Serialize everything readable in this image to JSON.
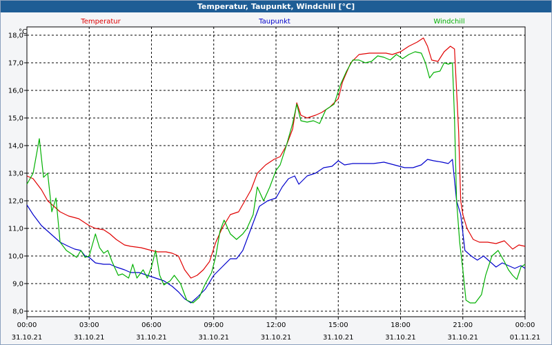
{
  "window": {
    "title": "Temperatur, Taupunkt, Windchill [°C]"
  },
  "chart_data": {
    "type": "line",
    "ylabel": "°C",
    "ylim": [
      7.8,
      18.3
    ],
    "yticks": [
      8.0,
      9.0,
      10.0,
      11.0,
      12.0,
      13.0,
      14.0,
      15.0,
      16.0,
      17.0,
      18.0
    ],
    "ytick_labels": [
      "8,0",
      "9,0",
      "10,0",
      "11,0",
      "12,0",
      "13,0",
      "14,0",
      "15,0",
      "16,0",
      "17,0",
      "18,0"
    ],
    "xlim": [
      0,
      24
    ],
    "xticks": [
      0,
      3,
      6,
      9,
      12,
      15,
      18,
      21,
      24
    ],
    "xtick_labels": [
      [
        "00:00",
        "31.10.21"
      ],
      [
        "03:00",
        "31.10.21"
      ],
      [
        "06:00",
        "31.10.21"
      ],
      [
        "09:00",
        "31.10.21"
      ],
      [
        "12:00",
        "31.10.21"
      ],
      [
        "15:00",
        "31.10.21"
      ],
      [
        "18:00",
        "31.10.21"
      ],
      [
        "21:00",
        "31.10.21"
      ],
      [
        "00:00",
        "01.11.21"
      ]
    ],
    "grid": true,
    "legend_position": "top",
    "series": [
      {
        "name": "Temperatur",
        "color": "#e00000",
        "points": [
          [
            0.0,
            12.9
          ],
          [
            0.3,
            12.8
          ],
          [
            0.7,
            12.4
          ],
          [
            1.0,
            12.0
          ],
          [
            1.3,
            11.8
          ],
          [
            1.6,
            11.6
          ],
          [
            2.0,
            11.45
          ],
          [
            2.5,
            11.35
          ],
          [
            2.8,
            11.2
          ],
          [
            3.0,
            11.1
          ],
          [
            3.3,
            11.0
          ],
          [
            3.7,
            10.95
          ],
          [
            4.0,
            10.8
          ],
          [
            4.3,
            10.6
          ],
          [
            4.7,
            10.4
          ],
          [
            5.0,
            10.35
          ],
          [
            5.5,
            10.3
          ],
          [
            6.0,
            10.2
          ],
          [
            6.3,
            10.15
          ],
          [
            6.7,
            10.15
          ],
          [
            7.0,
            10.1
          ],
          [
            7.3,
            10.0
          ],
          [
            7.6,
            9.5
          ],
          [
            7.9,
            9.2
          ],
          [
            8.2,
            9.3
          ],
          [
            8.5,
            9.5
          ],
          [
            8.8,
            9.8
          ],
          [
            9.1,
            10.5
          ],
          [
            9.4,
            11.0
          ],
          [
            9.8,
            11.5
          ],
          [
            10.2,
            11.6
          ],
          [
            10.5,
            12.0
          ],
          [
            10.8,
            12.4
          ],
          [
            11.1,
            13.0
          ],
          [
            11.5,
            13.3
          ],
          [
            11.9,
            13.5
          ],
          [
            12.2,
            13.6
          ],
          [
            12.5,
            14.0
          ],
          [
            12.8,
            14.6
          ],
          [
            13.0,
            15.55
          ],
          [
            13.2,
            15.1
          ],
          [
            13.5,
            15.0
          ],
          [
            13.9,
            15.1
          ],
          [
            14.2,
            15.2
          ],
          [
            14.6,
            15.4
          ],
          [
            15.0,
            15.7
          ],
          [
            15.2,
            16.3
          ],
          [
            15.6,
            17.0
          ],
          [
            16.0,
            17.3
          ],
          [
            16.5,
            17.35
          ],
          [
            16.9,
            17.35
          ],
          [
            17.3,
            17.35
          ],
          [
            17.6,
            17.3
          ],
          [
            18.0,
            17.4
          ],
          [
            18.4,
            17.6
          ],
          [
            18.8,
            17.75
          ],
          [
            19.1,
            17.9
          ],
          [
            19.3,
            17.6
          ],
          [
            19.5,
            17.1
          ],
          [
            19.8,
            17.05
          ],
          [
            20.1,
            17.4
          ],
          [
            20.4,
            17.6
          ],
          [
            20.6,
            17.5
          ],
          [
            20.8,
            14.5
          ],
          [
            20.9,
            12.0
          ],
          [
            21.0,
            11.5
          ],
          [
            21.2,
            11.0
          ],
          [
            21.5,
            10.6
          ],
          [
            21.8,
            10.5
          ],
          [
            22.2,
            10.5
          ],
          [
            22.6,
            10.45
          ],
          [
            23.0,
            10.55
          ],
          [
            23.4,
            10.25
          ],
          [
            23.7,
            10.4
          ],
          [
            24.0,
            10.35
          ]
        ]
      },
      {
        "name": "Taupunkt",
        "color": "#0000cc",
        "points": [
          [
            0.0,
            11.85
          ],
          [
            0.3,
            11.5
          ],
          [
            0.7,
            11.1
          ],
          [
            1.0,
            10.9
          ],
          [
            1.3,
            10.7
          ],
          [
            1.6,
            10.5
          ],
          [
            2.0,
            10.35
          ],
          [
            2.3,
            10.25
          ],
          [
            2.6,
            10.2
          ],
          [
            2.8,
            10.0
          ],
          [
            3.0,
            9.95
          ],
          [
            3.3,
            9.75
          ],
          [
            3.7,
            9.7
          ],
          [
            4.0,
            9.7
          ],
          [
            4.3,
            9.6
          ],
          [
            4.7,
            9.5
          ],
          [
            5.0,
            9.4
          ],
          [
            5.4,
            9.4
          ],
          [
            5.8,
            9.3
          ],
          [
            6.2,
            9.2
          ],
          [
            6.6,
            9.1
          ],
          [
            7.0,
            8.9
          ],
          [
            7.3,
            8.7
          ],
          [
            7.6,
            8.45
          ],
          [
            7.9,
            8.3
          ],
          [
            8.2,
            8.5
          ],
          [
            8.6,
            8.8
          ],
          [
            9.0,
            9.3
          ],
          [
            9.4,
            9.6
          ],
          [
            9.8,
            9.9
          ],
          [
            10.1,
            9.9
          ],
          [
            10.4,
            10.2
          ],
          [
            10.8,
            11.0
          ],
          [
            11.2,
            11.8
          ],
          [
            11.6,
            12.0
          ],
          [
            12.0,
            12.1
          ],
          [
            12.3,
            12.5
          ],
          [
            12.6,
            12.8
          ],
          [
            12.9,
            12.9
          ],
          [
            13.1,
            12.6
          ],
          [
            13.5,
            12.9
          ],
          [
            13.9,
            13.0
          ],
          [
            14.3,
            13.2
          ],
          [
            14.7,
            13.25
          ],
          [
            15.0,
            13.45
          ],
          [
            15.3,
            13.3
          ],
          [
            15.7,
            13.35
          ],
          [
            16.2,
            13.35
          ],
          [
            16.7,
            13.35
          ],
          [
            17.2,
            13.4
          ],
          [
            17.7,
            13.3
          ],
          [
            18.2,
            13.2
          ],
          [
            18.6,
            13.2
          ],
          [
            19.0,
            13.3
          ],
          [
            19.3,
            13.5
          ],
          [
            19.6,
            13.45
          ],
          [
            20.0,
            13.4
          ],
          [
            20.3,
            13.35
          ],
          [
            20.5,
            13.5
          ],
          [
            20.7,
            12.0
          ],
          [
            20.9,
            11.5
          ],
          [
            21.1,
            10.2
          ],
          [
            21.4,
            10.0
          ],
          [
            21.7,
            9.85
          ],
          [
            22.0,
            10.0
          ],
          [
            22.3,
            9.8
          ],
          [
            22.6,
            9.6
          ],
          [
            22.9,
            9.75
          ],
          [
            23.2,
            9.65
          ],
          [
            23.5,
            9.55
          ],
          [
            23.8,
            9.65
          ],
          [
            24.0,
            9.55
          ]
        ]
      },
      {
        "name": "Windchill",
        "color": "#00b000",
        "points": [
          [
            0.0,
            12.6
          ],
          [
            0.3,
            13.0
          ],
          [
            0.6,
            14.25
          ],
          [
            0.8,
            12.85
          ],
          [
            1.0,
            13.0
          ],
          [
            1.2,
            11.6
          ],
          [
            1.4,
            12.1
          ],
          [
            1.6,
            10.5
          ],
          [
            1.9,
            10.2
          ],
          [
            2.1,
            10.1
          ],
          [
            2.4,
            9.95
          ],
          [
            2.6,
            10.2
          ],
          [
            2.8,
            9.95
          ],
          [
            3.0,
            10.0
          ],
          [
            3.3,
            10.8
          ],
          [
            3.5,
            10.3
          ],
          [
            3.7,
            10.1
          ],
          [
            3.9,
            10.2
          ],
          [
            4.1,
            9.8
          ],
          [
            4.4,
            9.3
          ],
          [
            4.6,
            9.35
          ],
          [
            4.9,
            9.2
          ],
          [
            5.1,
            9.7
          ],
          [
            5.3,
            9.2
          ],
          [
            5.6,
            9.5
          ],
          [
            5.8,
            9.2
          ],
          [
            6.0,
            9.6
          ],
          [
            6.2,
            10.2
          ],
          [
            6.4,
            9.3
          ],
          [
            6.6,
            8.95
          ],
          [
            6.9,
            9.1
          ],
          [
            7.1,
            9.3
          ],
          [
            7.4,
            9.0
          ],
          [
            7.7,
            8.4
          ],
          [
            8.0,
            8.3
          ],
          [
            8.3,
            8.5
          ],
          [
            8.6,
            9.0
          ],
          [
            8.9,
            9.4
          ],
          [
            9.1,
            10.0
          ],
          [
            9.3,
            10.9
          ],
          [
            9.5,
            11.3
          ],
          [
            9.8,
            10.8
          ],
          [
            10.1,
            10.6
          ],
          [
            10.4,
            10.8
          ],
          [
            10.6,
            11.0
          ],
          [
            10.9,
            11.5
          ],
          [
            11.1,
            12.5
          ],
          [
            11.4,
            12.0
          ],
          [
            11.7,
            12.5
          ],
          [
            12.0,
            13.1
          ],
          [
            12.2,
            13.3
          ],
          [
            12.5,
            14.0
          ],
          [
            12.8,
            14.8
          ],
          [
            13.0,
            15.5
          ],
          [
            13.2,
            14.9
          ],
          [
            13.5,
            14.85
          ],
          [
            13.8,
            14.9
          ],
          [
            14.1,
            14.8
          ],
          [
            14.4,
            15.3
          ],
          [
            14.8,
            15.5
          ],
          [
            15.1,
            16.2
          ],
          [
            15.4,
            16.7
          ],
          [
            15.7,
            17.1
          ],
          [
            16.0,
            17.1
          ],
          [
            16.3,
            17.0
          ],
          [
            16.6,
            17.05
          ],
          [
            16.9,
            17.25
          ],
          [
            17.2,
            17.2
          ],
          [
            17.5,
            17.1
          ],
          [
            17.8,
            17.3
          ],
          [
            18.1,
            17.15
          ],
          [
            18.4,
            17.3
          ],
          [
            18.7,
            17.4
          ],
          [
            19.0,
            17.35
          ],
          [
            19.2,
            17.0
          ],
          [
            19.4,
            16.45
          ],
          [
            19.6,
            16.65
          ],
          [
            19.9,
            16.7
          ],
          [
            20.1,
            17.0
          ],
          [
            20.3,
            16.95
          ],
          [
            20.5,
            17.0
          ],
          [
            20.6,
            15.0
          ],
          [
            20.7,
            12.0
          ],
          [
            20.85,
            10.5
          ],
          [
            21.0,
            9.5
          ],
          [
            21.15,
            8.4
          ],
          [
            21.35,
            8.3
          ],
          [
            21.6,
            8.3
          ],
          [
            21.9,
            8.6
          ],
          [
            22.1,
            9.3
          ],
          [
            22.4,
            10.0
          ],
          [
            22.7,
            10.2
          ],
          [
            23.0,
            9.8
          ],
          [
            23.2,
            9.5
          ],
          [
            23.4,
            9.3
          ],
          [
            23.6,
            9.15
          ],
          [
            23.8,
            9.6
          ],
          [
            24.0,
            9.7
          ]
        ]
      }
    ]
  }
}
